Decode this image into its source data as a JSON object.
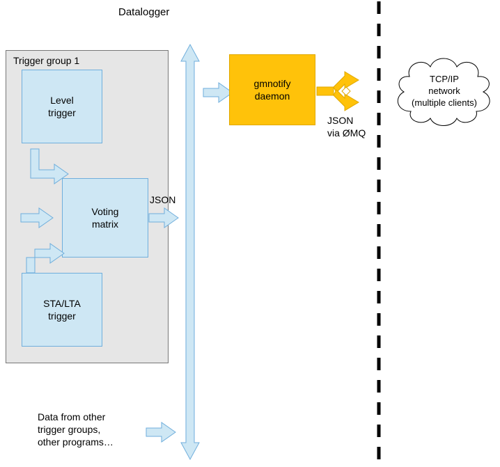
{
  "header": {
    "title": "Datalogger"
  },
  "trigger_group": {
    "title": "Trigger group 1",
    "level": "Level\ntrigger",
    "voting": "Voting\nmatrix",
    "stalta": "STA/LTA\ntrigger"
  },
  "labels": {
    "json": "JSON",
    "json_zmq": "JSON\nvia ØMQ",
    "other_data": "Data from other\ntrigger groups,\nother programs…"
  },
  "daemon": {
    "label": "gmnotify\ndaemon"
  },
  "network": {
    "label": "TCP/IP\nnetwork\n(multiple clients)"
  }
}
